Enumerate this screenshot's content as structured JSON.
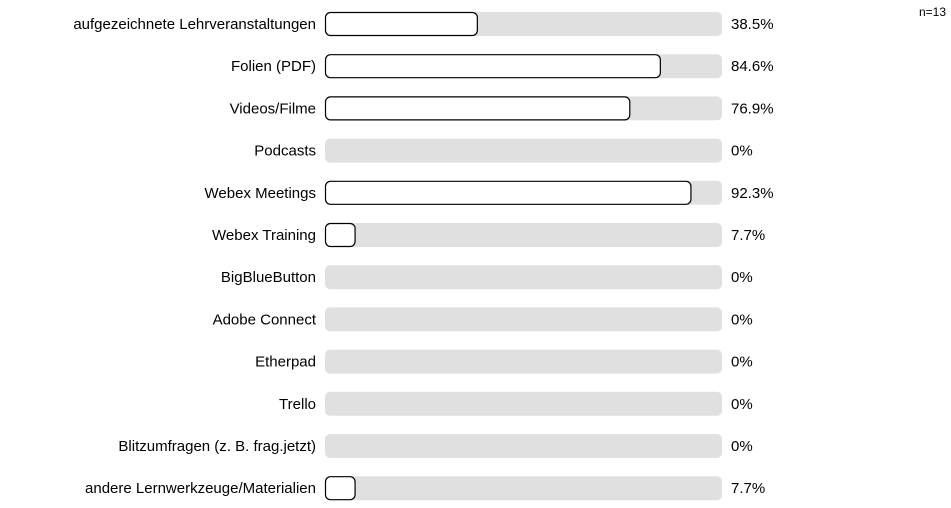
{
  "chart_data": {
    "type": "bar",
    "orientation": "horizontal",
    "n_label": "n=13",
    "categories": [
      "aufgezeichnete Lehrveranstaltungen",
      "Folien (PDF)",
      "Videos/Filme",
      "Podcasts",
      "Webex Meetings",
      "Webex Training",
      "BigBlueButton",
      "Adobe Connect",
      "Etherpad",
      "Trello",
      "Blitzumfragen (z. B. frag.jetzt)",
      "andere Lernwerkzeuge/Materialien"
    ],
    "values": [
      38.5,
      84.6,
      76.9,
      0,
      92.3,
      7.7,
      0,
      0,
      0,
      0,
      0,
      7.7
    ],
    "value_labels": [
      "38.5%",
      "84.6%",
      "76.9%",
      "0%",
      "92.3%",
      "7.7%",
      "0%",
      "0%",
      "0%",
      "0%",
      "0%",
      "7.7%"
    ],
    "xlim": [
      0,
      100
    ],
    "grid": false,
    "legend": "none",
    "colors": {
      "track": "#e0e0e0",
      "bar_fill": "#ffffff",
      "bar_stroke": "#000000"
    }
  }
}
